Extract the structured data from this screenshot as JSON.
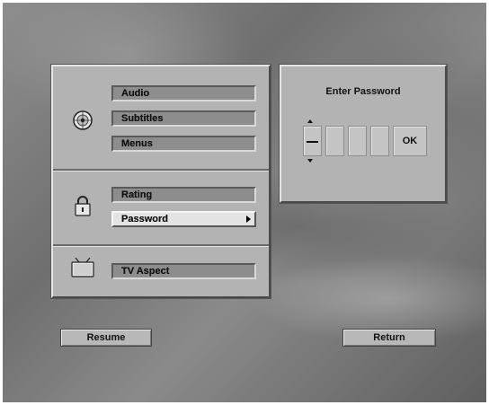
{
  "menu": {
    "audio_label": "Audio",
    "subtitles_label": "Subtitles",
    "menus_label": "Menus",
    "rating_label": "Rating",
    "password_label": "Password",
    "tv_aspect_label": "TV Aspect"
  },
  "password_dialog": {
    "title": "Enter Password",
    "ok_label": "OK"
  },
  "footer": {
    "resume_label": "Resume",
    "return_label": "Return"
  },
  "icons": [
    "disc-icon",
    "padlock-icon",
    "tv-icon",
    "spin-up-icon",
    "spin-down-icon"
  ]
}
